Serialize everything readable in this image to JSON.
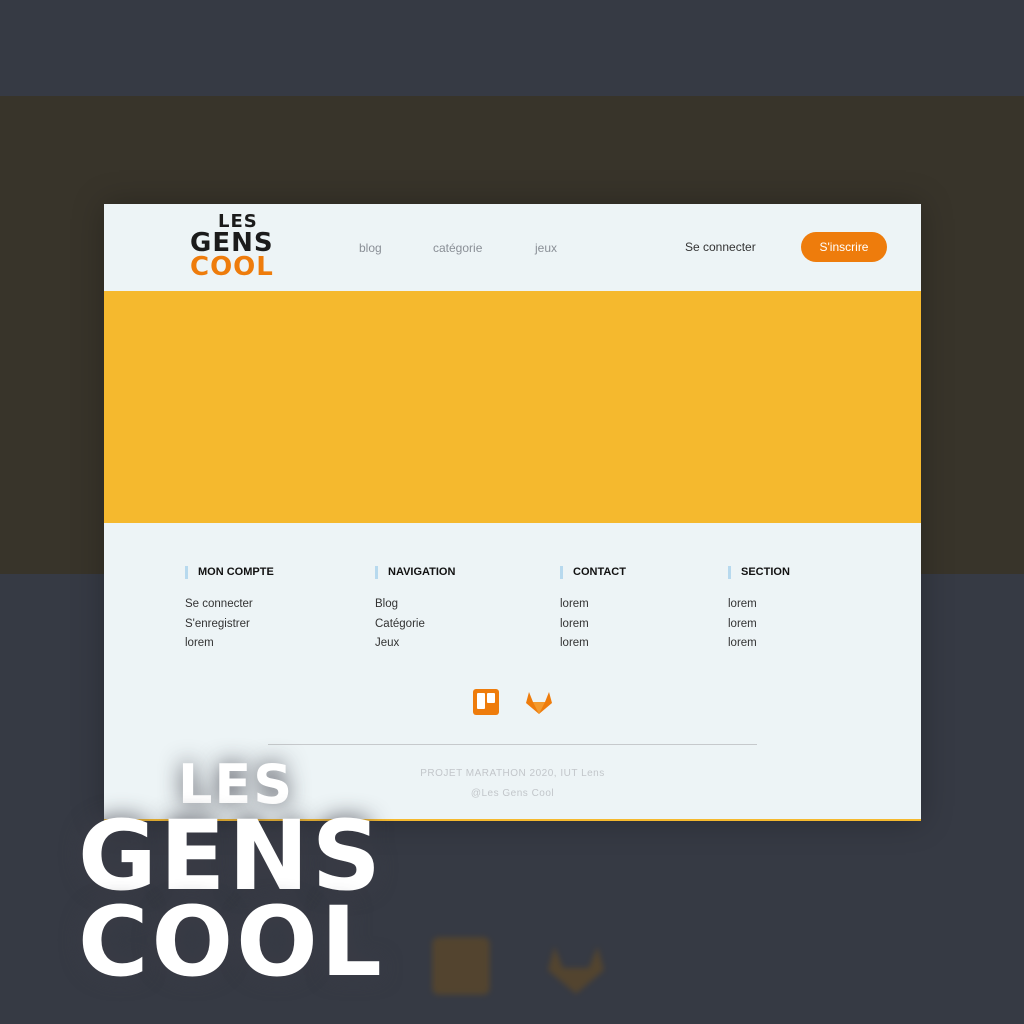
{
  "logo": {
    "line1": "LES",
    "line2": "GENS",
    "line3": "COOL"
  },
  "nav": {
    "blog": "blog",
    "categorie": "catégorie",
    "jeux": "jeux"
  },
  "auth": {
    "login": "Se connecter",
    "signup": "S'inscrire"
  },
  "footer": {
    "columns": [
      {
        "title": "MON COMPTE",
        "items": [
          "Se connecter",
          "S'enregistrer",
          "lorem"
        ]
      },
      {
        "title": "NAVIGATION",
        "items": [
          "Blog",
          "Catégorie",
          "Jeux"
        ]
      },
      {
        "title": "CONTACT",
        "items": [
          "lorem",
          "lorem",
          "lorem"
        ]
      },
      {
        "title": "SECTION",
        "items": [
          "lorem",
          "lorem",
          "lorem"
        ]
      }
    ],
    "social": [
      "trello-icon",
      "gitlab-icon"
    ],
    "copyright_line1": "PROJET MARATHON 2020, IUT Lens",
    "copyright_line2": "@Les Gens Cool"
  },
  "colors": {
    "accent": "#ee7c0c",
    "hero": "#f5b92e",
    "page_bg": "#edf4f6"
  }
}
